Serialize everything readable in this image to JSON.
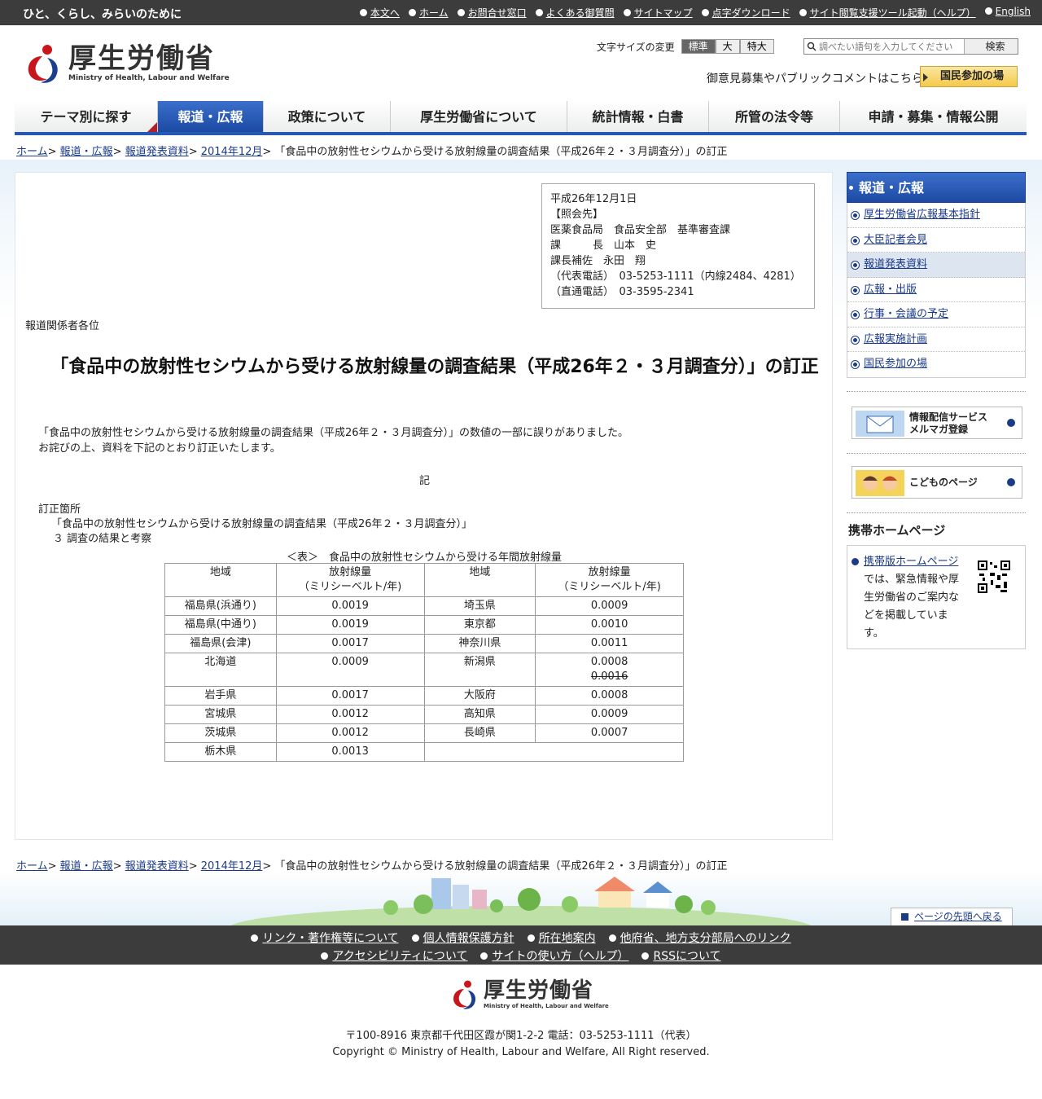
{
  "topbar": {
    "tagline": "ひと、くらし、みらいのために",
    "links": [
      "本文へ",
      "ホーム",
      "お問合せ窓口",
      "よくある御質問",
      "サイトマップ",
      "点字ダウンロード",
      "サイト閲覧支援ツール起動（ヘルプ）",
      "English"
    ]
  },
  "header": {
    "logo_ja": "厚生労働省",
    "logo_en": "Ministry of Health, Labour and Welfare",
    "fontsize_label": "文字サイズの変更",
    "fontsize_options": [
      "標準",
      "大",
      "特大"
    ],
    "search_placeholder": "調べたい語句を入力してください",
    "search_button": "検索",
    "pubcomment": "御意見募集やパブリックコメントはこちら",
    "kokumin_button": "国民参加の場"
  },
  "gnav": [
    "テーマ別に探す",
    "報道・広報",
    "政策について",
    "厚生労働省について",
    "統計情報・白書",
    "所管の法令等",
    "申請・募集・情報公開"
  ],
  "breadcrumb": {
    "items": [
      "ホーム",
      "報道・広報",
      "報道発表資料",
      "2014年12月"
    ],
    "current": "「食品中の放射性セシウムから受ける放射線量の調査結果（平成26年２・３月調査分）」の訂正"
  },
  "contact": {
    "date": "平成26年12月1日",
    "heading": "【照会先】",
    "dept": "医薬食品局　食品安全部　基準審査課",
    "chief": "課　　　長　山本　史",
    "assistant": "課長補佐　永田　翔",
    "phone_main": "（代表電話）　03-5253-1111（内線2484、4281）",
    "phone_direct": "（直通電話）　03-3595-2341"
  },
  "article": {
    "addressee": "報道関係者各位",
    "title": "「食品中の放射性セシウムから受ける放射線量の調査結果（平成26年２・３月調査分）」の訂正",
    "body_line1": "「食品中の放射性セシウムから受ける放射線量の調査結果（平成26年２・３月調査分）」の数値の一部に誤りがありました。",
    "body_line2": "お詫びの上、資料を下記のとおり訂正いたします。",
    "ki": "記",
    "teisei_label": "訂正箇所",
    "teisei_doc": "「食品中の放射性セシウムから受ける放射線量の調査結果（平成26年２・３月調査分）」",
    "teisei_section": "３ 調査の結果と考察",
    "table_caption": "＜表＞　食品中の放射性セシウムから受ける年間放射線量",
    "table_headers": [
      "地域",
      "放射線量",
      "（ミリシーベルト/年)",
      "地域",
      "放射線量",
      "（ミリシーベルト/年)"
    ],
    "rows": [
      {
        "r1": "福島県(浜通り)",
        "v1": "0.0019",
        "r2": "埼玉県",
        "v2": "0.0009",
        "old": ""
      },
      {
        "r1": "福島県(中通り)",
        "v1": "0.0019",
        "r2": "東京都",
        "v2": "0.0010",
        "old": ""
      },
      {
        "r1": "福島県(会津)",
        "v1": "0.0017",
        "r2": "神奈川県",
        "v2": "0.0011",
        "old": ""
      },
      {
        "r1": "北海道",
        "v1": "0.0009",
        "r2": "新潟県",
        "v2": "0.0008",
        "old": "0.0016"
      },
      {
        "r1": "岩手県",
        "v1": "0.0017",
        "r2": "大阪府",
        "v2": "0.0008",
        "old": ""
      },
      {
        "r1": "宮城県",
        "v1": "0.0012",
        "r2": "高知県",
        "v2": "0.0009",
        "old": ""
      },
      {
        "r1": "茨城県",
        "v1": "0.0012",
        "r2": "長崎県",
        "v2": "0.0007",
        "old": ""
      },
      {
        "r1": "栃木県",
        "v1": "0.0013",
        "r2": "",
        "v2": "",
        "old": ""
      }
    ]
  },
  "sidebar": {
    "heading": "報道・広報",
    "items": [
      "厚生労働省広報基本指針",
      "大臣記者会見",
      "報道発表資料",
      "広報・出版",
      "行事・会議の予定",
      "広報実施計画",
      "国民参加の場"
    ],
    "mail_banner_line1": "情報配信サービス",
    "mail_banner_line2": "メルマガ登録",
    "kids_banner": "こどものページ",
    "mobile_title": "携帯ホームページ",
    "mobile_link": "携帯版ホームページ",
    "mobile_text": "では、緊急情報や厚生労働省のご案内などを掲載しています。"
  },
  "footer": {
    "pagetop": "ページの先頭へ戻る",
    "links_row1": [
      "リンク・著作権等について",
      "個人情報保護方針",
      "所在地案内",
      "他府省、地方支分部局へのリンク"
    ],
    "links_row2": [
      "アクセシビリティについて",
      "サイトの使い方（ヘルプ）",
      "RSSについて"
    ],
    "address": "〒100-8916 東京都千代田区霞が関1-2-2 電話：03-5253-1111（代表）",
    "copyright": "Copyright © Ministry of Health, Labour and Welfare, All Right reserved."
  },
  "colors": {
    "brand_blue": "#1c4aa3",
    "logo_red": "#c8161d",
    "logo_blue": "#1a3f8f",
    "bar": "#3c3c3c"
  }
}
